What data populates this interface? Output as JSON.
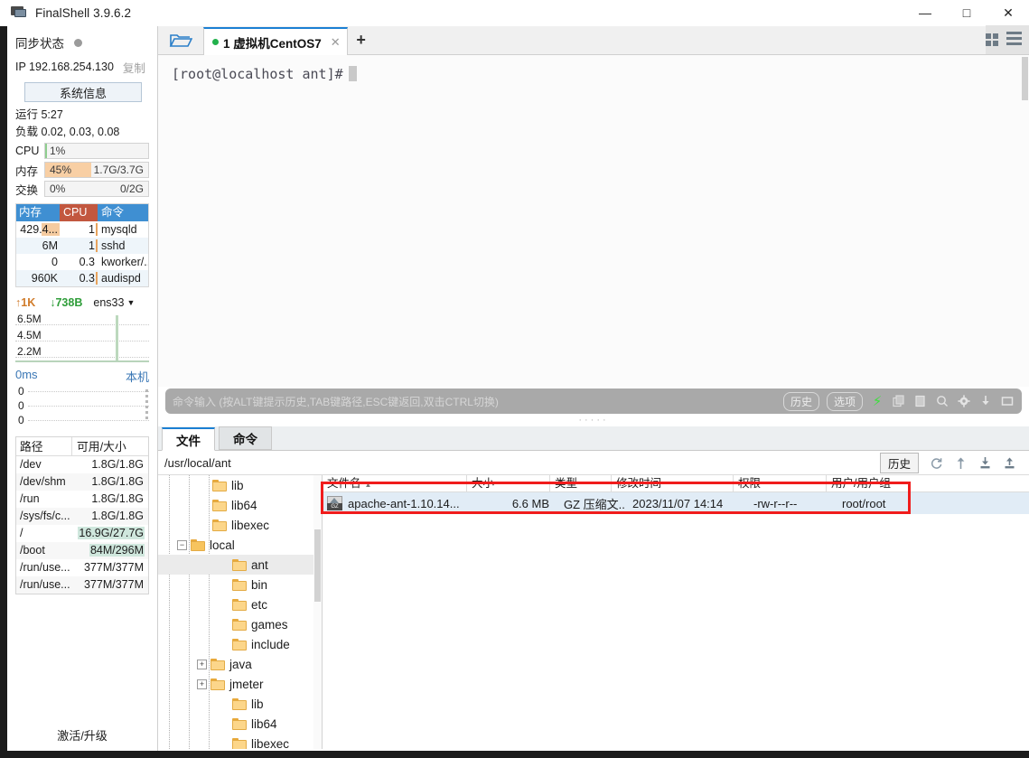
{
  "window": {
    "title": "FinalShell 3.9.6.2",
    "app_icon": "monitor-icon",
    "minimize": "—",
    "maximize": "□",
    "close": "✕"
  },
  "sidebar": {
    "sync_label": "同步状态",
    "ip_text": "IP 192.168.254.130",
    "copy_label": "复制",
    "sysinfo_button": "系统信息",
    "uptime": "运行 5:27",
    "load": "负载 0.02, 0.03, 0.08",
    "bars": [
      {
        "label": "CPU",
        "pct": "1%",
        "value": "",
        "fill_pct": 2,
        "color": "#8fce8f"
      },
      {
        "label": "内存",
        "pct": "45%",
        "value": "1.7G/3.7G",
        "fill_pct": 45,
        "color": "#f8cfa4"
      },
      {
        "label": "交换",
        "pct": "0%",
        "value": "0/2G",
        "fill_pct": 0,
        "color": "#f8cfa4"
      }
    ],
    "proc_table": {
      "headers": [
        "内存",
        "CPU",
        "命令"
      ],
      "rows": [
        {
          "mem": "429.4...",
          "cpu": "1",
          "cmd": "mysqld",
          "mem_bar": 20,
          "cpu_bar": true
        },
        {
          "mem": "6M",
          "cpu": "1",
          "cmd": "sshd",
          "mem_bar": 0,
          "cpu_bar": true
        },
        {
          "mem": "0",
          "cpu": "0.3",
          "cmd": "kworker/...",
          "mem_bar": 0,
          "cpu_bar": false
        },
        {
          "mem": "960K",
          "cpu": "0.3",
          "cmd": "audispd",
          "mem_bar": 0,
          "cpu_bar": true
        }
      ]
    },
    "network": {
      "upload": "↑1K",
      "download": "↓738B",
      "interface": "ens33",
      "caret": "▼",
      "y_labels": [
        "6.5M",
        "4.5M",
        "2.2M"
      ]
    },
    "latency": {
      "ms": "0ms",
      "host": "本机",
      "y_labels": [
        "0",
        "0",
        "0"
      ]
    },
    "disk_table": {
      "headers": [
        "路径",
        "可用/大小"
      ],
      "rows": [
        {
          "path": "/dev",
          "size": "1.8G/1.8G",
          "highlight": false
        },
        {
          "path": "/dev/shm",
          "size": "1.8G/1.8G",
          "highlight": false
        },
        {
          "path": "/run",
          "size": "1.8G/1.8G",
          "highlight": false
        },
        {
          "path": "/sys/fs/c...",
          "size": "1.8G/1.8G",
          "highlight": false
        },
        {
          "path": "/",
          "size": "16.9G/27.7G",
          "highlight": true
        },
        {
          "path": "/boot",
          "size": "84M/296M",
          "highlight": true
        },
        {
          "path": "/run/use...",
          "size": "377M/377M",
          "highlight": false
        },
        {
          "path": "/run/use...",
          "size": "377M/377M",
          "highlight": false
        }
      ]
    },
    "activate_label": "激活/升级"
  },
  "tabbar": {
    "folder_icon": "open-folder-icon",
    "tab_number": "1",
    "tab_label": "1 虚拟机CentOS7",
    "tab_close": "✕",
    "new_tab": "+",
    "grid_icon": "grid-view-icon",
    "list_icon": "list-view-icon"
  },
  "terminal": {
    "prompt": "[root@localhost ant]#"
  },
  "command_bar": {
    "placeholder": "命令输入 (按ALT键提示历史,TAB键路径,ESC键返回,双击CTRL切换)",
    "history_label": "历史",
    "options_label": "选项",
    "icons": [
      "bolt-icon",
      "copy-icon",
      "paste-icon",
      "search-icon",
      "gear-icon",
      "download-icon",
      "window-icon"
    ]
  },
  "file_panel": {
    "tabs": [
      {
        "label": "文件",
        "active": true
      },
      {
        "label": "命令",
        "active": false
      }
    ],
    "path": "/usr/local/ant",
    "history_label": "历史",
    "toolbar_icons": [
      "refresh-icon",
      "up-level-icon",
      "download-icon",
      "upload-icon"
    ],
    "tree": [
      {
        "label": "lib",
        "depth": 2,
        "expander": "",
        "selected": false,
        "open": false
      },
      {
        "label": "lib64",
        "depth": 2,
        "expander": "",
        "selected": false,
        "open": false
      },
      {
        "label": "libexec",
        "depth": 2,
        "expander": "",
        "selected": false,
        "open": false
      },
      {
        "label": "local",
        "depth": 1,
        "expander": "−",
        "selected": false,
        "open": true
      },
      {
        "label": "ant",
        "depth": 3,
        "expander": "",
        "selected": true,
        "open": false
      },
      {
        "label": "bin",
        "depth": 3,
        "expander": "",
        "selected": false,
        "open": false
      },
      {
        "label": "etc",
        "depth": 3,
        "expander": "",
        "selected": false,
        "open": false
      },
      {
        "label": "games",
        "depth": 3,
        "expander": "",
        "selected": false,
        "open": false
      },
      {
        "label": "include",
        "depth": 3,
        "expander": "",
        "selected": false,
        "open": false
      },
      {
        "label": "java",
        "depth": 2,
        "expander": "+",
        "selected": false,
        "open": false
      },
      {
        "label": "jmeter",
        "depth": 2,
        "expander": "+",
        "selected": false,
        "open": false
      },
      {
        "label": "lib",
        "depth": 3,
        "expander": "",
        "selected": false,
        "open": false
      },
      {
        "label": "lib64",
        "depth": 3,
        "expander": "",
        "selected": false,
        "open": false
      },
      {
        "label": "libexec",
        "depth": 3,
        "expander": "",
        "selected": false,
        "open": false
      }
    ],
    "list_headers": [
      "文件名",
      "大小",
      "类型",
      "修改时间",
      "权限",
      "用户/用户组"
    ],
    "sort_caret": "▲",
    "rows": [
      {
        "name": "apache-ant-1.10.14...",
        "size": "6.6 MB",
        "type": "GZ 压缩文...",
        "mtime": "2023/11/07 14:14",
        "perm": "-rw-r--r--",
        "owner": "root/root",
        "icon": "gz-archive-icon",
        "icon_badge": "GZ"
      }
    ]
  },
  "annotation": {
    "highlight_color": "#f01c1c"
  }
}
